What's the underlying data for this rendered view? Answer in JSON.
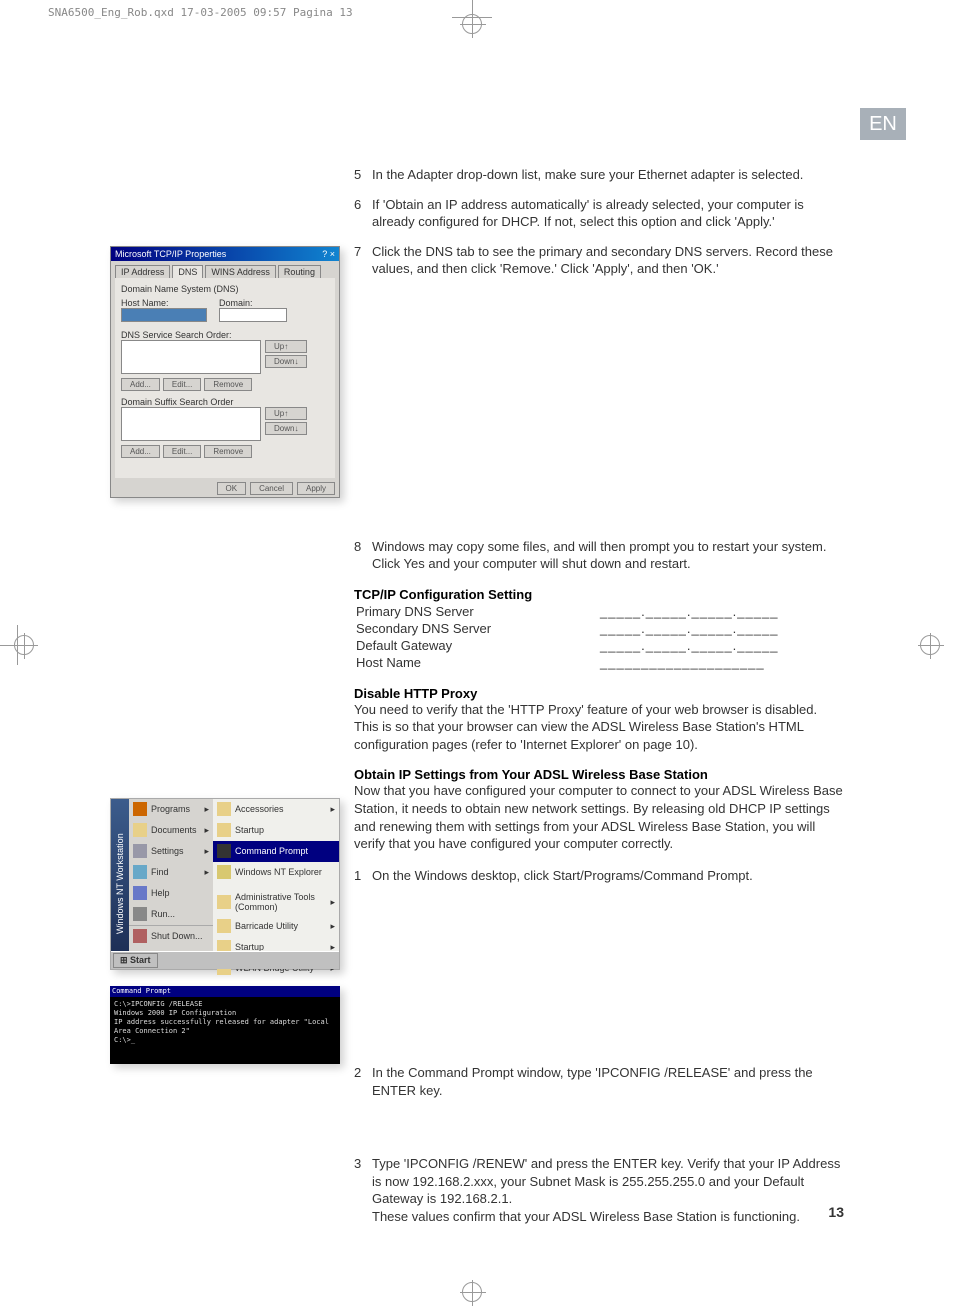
{
  "print_header": "SNA6500_Eng_Rob.qxd  17-03-2005  09:57  Pagina 13",
  "lang_badge": "EN",
  "steps": {
    "s5": "In the Adapter drop-down list, make sure your Ethernet adapter is selected.",
    "s6": "If 'Obtain an IP address automatically' is already selected, your computer is already configured for DHCP. If not, select this option and click 'Apply.'",
    "s7": "Click the DNS tab to see the primary and secondary DNS servers. Record these values, and then click 'Remove.' Click 'Apply', and then 'OK.'",
    "s8": "Windows may copy some files, and will then prompt you to restart your system. Click Yes and your computer will shut down and restart.",
    "s_cmd1": "On the Windows desktop, click Start/Programs/Command Prompt.",
    "s_cmd2": "In the Command Prompt window, type 'IPCONFIG /RELEASE' and press the ENTER key.",
    "s_cmd3": "Type 'IPCONFIG /RENEW' and press the ENTER key. Verify that your IP Address is now 192.168.2.xxx, your Subnet Mask is 255.255.255.0 and your Default Gateway is 192.168.2.1.",
    "s_cmd3b": "These values confirm that your ADSL Wireless Base Station is functioning."
  },
  "step_nums": {
    "n5": "5",
    "n6": "6",
    "n7": "7",
    "n8": "8",
    "c1": "1",
    "c2": "2",
    "c3": "3"
  },
  "tcpip_dialog": {
    "title": "Microsoft TCP/IP Properties",
    "tabs": {
      "ip": "IP Address",
      "dns": "DNS",
      "wins": "WINS Address",
      "routing": "Routing"
    },
    "dns_label": "Domain Name System (DNS)",
    "host_label": "Host Name:",
    "domain_label": "Domain:",
    "search_order_label": "DNS Service Search Order:",
    "suffix_label": "Domain Suffix Search Order",
    "btn_add": "Add...",
    "btn_edit": "Edit...",
    "btn_remove": "Remove",
    "btn_up": "Up↑",
    "btn_down": "Down↓",
    "btn_ok": "OK",
    "btn_cancel": "Cancel",
    "btn_apply": "Apply"
  },
  "tcpip_section": {
    "title": "TCP/IP Configuration Setting",
    "rows": {
      "r1": "Primary DNS Server",
      "r2": "Secondary DNS Server",
      "r3": "Default Gateway",
      "r4": "Host Name"
    },
    "blank_dots": "_____._____._____._____",
    "blank_line": "____________________"
  },
  "proxy_section": {
    "title": "Disable HTTP Proxy",
    "body": "You need to verify that the 'HTTP Proxy' feature of your web browser is disabled. This is so that your browser can view the ADSL Wireless Base Station's HTML configuration pages (refer to 'Internet Explorer' on page 10)."
  },
  "obtain_section": {
    "title": "Obtain IP Settings from Your ADSL Wireless Base Station",
    "body": "Now that you have configured your computer to connect to your ADSL Wireless Base Station, it needs to obtain new network settings. By releasing old DHCP IP settings and renewing them with settings from your ADSL Wireless Base Station, you will verify that you have configured your computer correctly."
  },
  "startmenu": {
    "bar": "Windows NT Workstation",
    "col1": {
      "programs": "Programs",
      "documents": "Documents",
      "settings": "Settings",
      "find": "Find",
      "help": "Help",
      "run": "Run...",
      "shutdown": "Shut Down..."
    },
    "col2": {
      "accessories": "Accessories",
      "startup": "Startup",
      "command_prompt": "Command Prompt",
      "nt_explorer": "Windows NT Explorer",
      "admin_tools": "Administrative Tools (Common)",
      "barricade": "Barricade Utility",
      "startup2": "Startup",
      "wlan": "WLAN Bridge Utility"
    },
    "start": "Start"
  },
  "cmd": {
    "title": "Command Prompt",
    "line1": "C:\\>IPCONFIG /RELEASE",
    "line2": "Windows 2000 IP Configuration",
    "line3": "IP address successfully released for adapter \"Local Area Connection 2\"",
    "line4": "C:\\>_"
  },
  "page_number": "13"
}
